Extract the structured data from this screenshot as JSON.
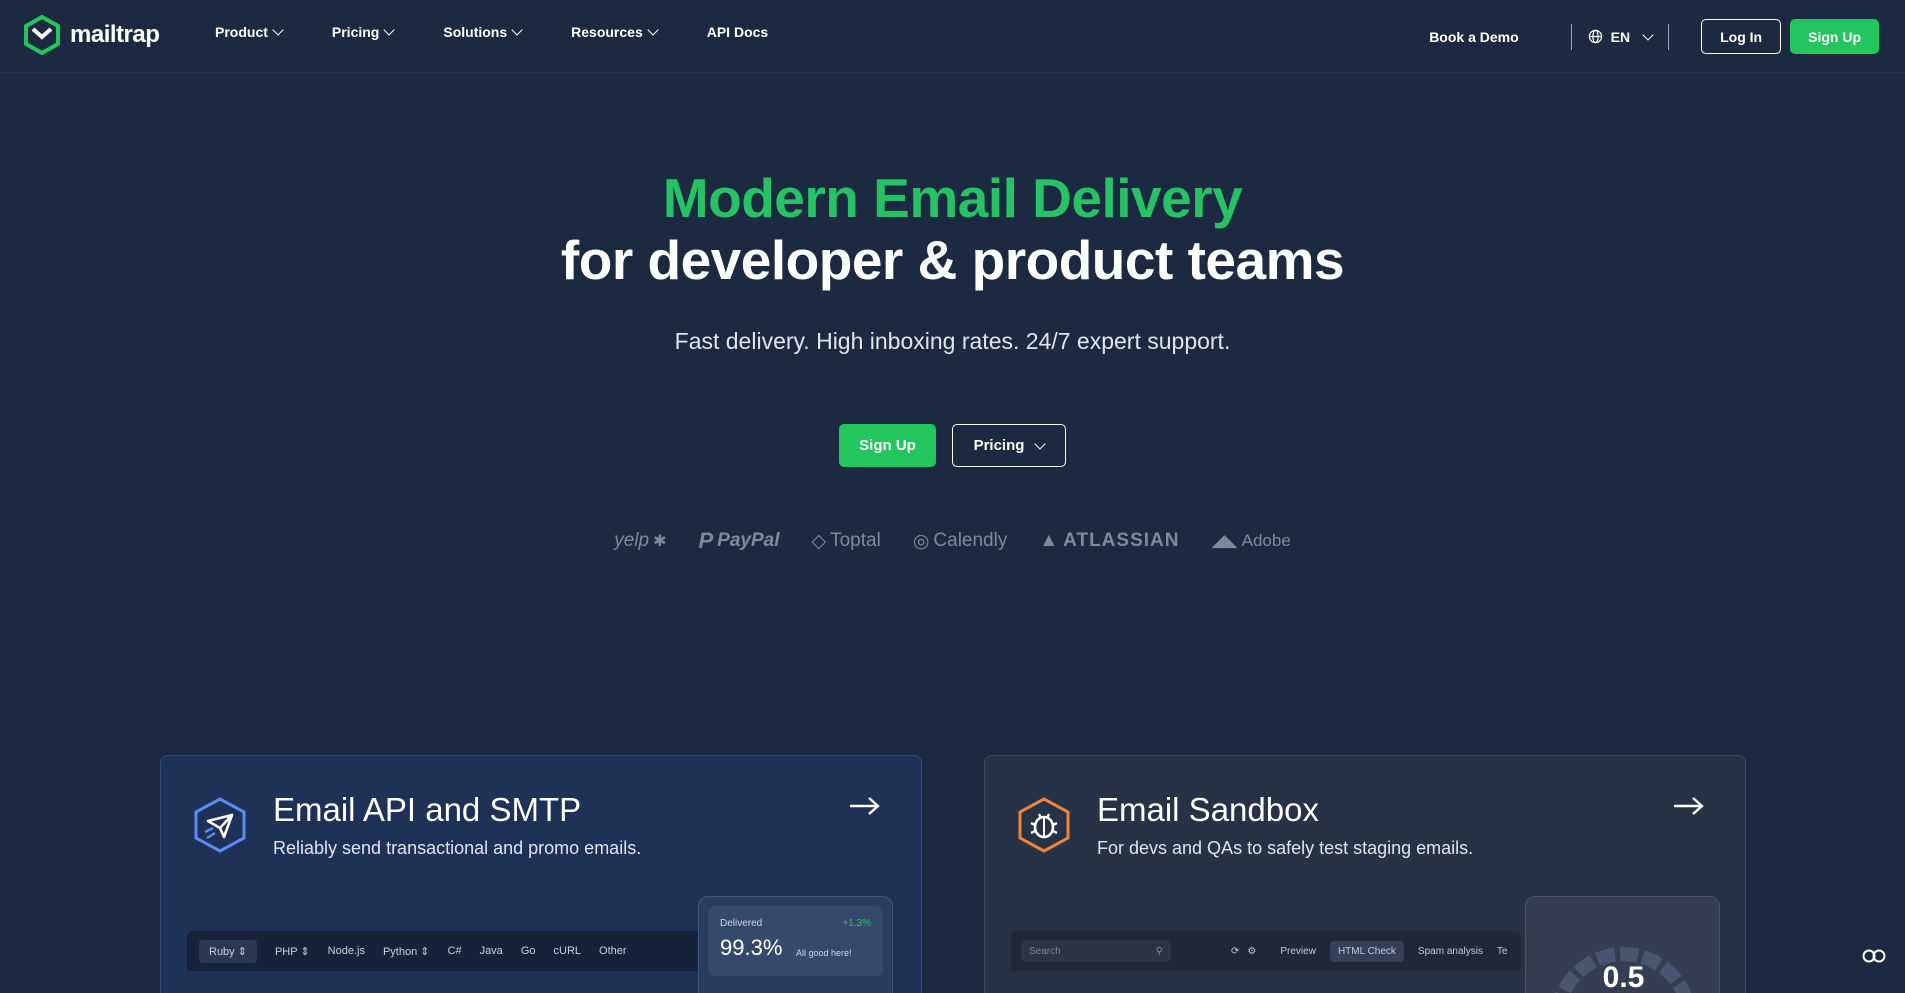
{
  "nav": {
    "logo_text": "mailtrap",
    "menu": [
      "Product",
      "Pricing",
      "Solutions",
      "Resources",
      "API Docs"
    ],
    "book_demo": "Book a Demo",
    "language": "EN",
    "login": "Log In",
    "signup": "Sign Up"
  },
  "hero": {
    "title_line1": "Modern Email Delivery",
    "title_line2": "for developer & product teams",
    "subtitle": "Fast delivery. High inboxing rates. 24/7 expert support.",
    "signup": "Sign Up",
    "pricing": "Pricing"
  },
  "logos": [
    "yelp",
    "PayPal",
    "Toptal",
    "Calendly",
    "ATLASSIAN",
    "Adobe"
  ],
  "cards": {
    "api": {
      "title": "Email API and SMTP",
      "desc": "Reliably send transactional and promo emails.",
      "languages": [
        "Ruby",
        "PHP",
        "Node.js",
        "Python",
        "C#",
        "Java",
        "Go",
        "cURL",
        "Other"
      ],
      "stat_label": "Delivered",
      "stat_delta": "+1.3%",
      "stat_value": "99.3%",
      "stat_note": "All good here!"
    },
    "sandbox": {
      "title": "Email Sandbox",
      "desc": "For devs and QAs to safely test staging emails.",
      "search_placeholder": "Search",
      "tabs": [
        "Preview",
        "HTML Check",
        "Spam analysis",
        "Te"
      ],
      "gauge_value": "0.5"
    }
  },
  "colors": {
    "background": "#1b2a40",
    "accent": "#22c55e"
  }
}
